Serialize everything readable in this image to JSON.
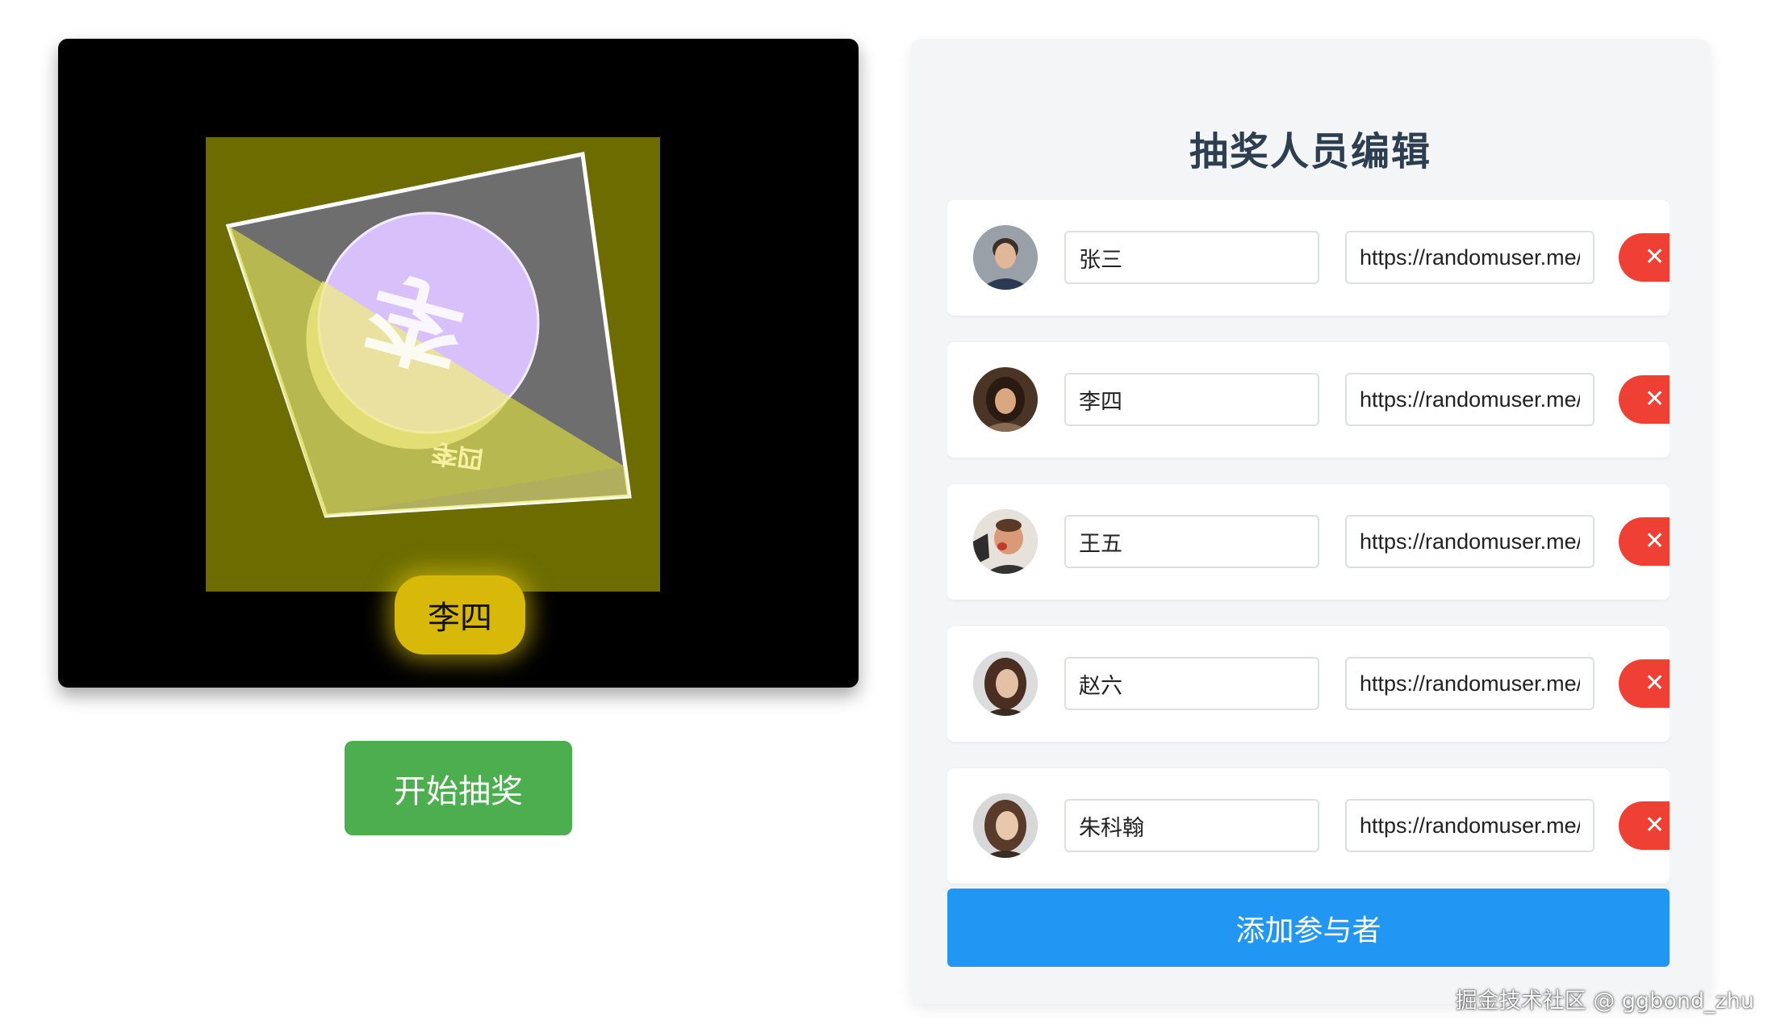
{
  "stage": {
    "card_name": "李四",
    "card_char": "李",
    "winner_name": "李四",
    "start_button": "开始抽奖"
  },
  "panel": {
    "title": "抽奖人员编辑",
    "add_button": "添加参与者",
    "delete_icon": "close-icon",
    "participants": [
      {
        "name": "张三",
        "avatar_url": "https://randomuser.me/a"
      },
      {
        "name": "李四",
        "avatar_url": "https://randomuser.me/a"
      },
      {
        "name": "王五",
        "avatar_url": "https://randomuser.me/a"
      },
      {
        "name": "赵六",
        "avatar_url": "https://randomuser.me/a"
      },
      {
        "name": "朱科翰",
        "avatar_url": "https://randomuser.me/a"
      }
    ]
  },
  "watermark": "掘金技术社区 @ ggbond_zhu",
  "colors": {
    "start_button": "#4cae4f",
    "add_button": "#2196f3",
    "delete_button": "#ee4035",
    "winner_badge": "#d8b809",
    "card_highlight": "#d8c1fa"
  }
}
